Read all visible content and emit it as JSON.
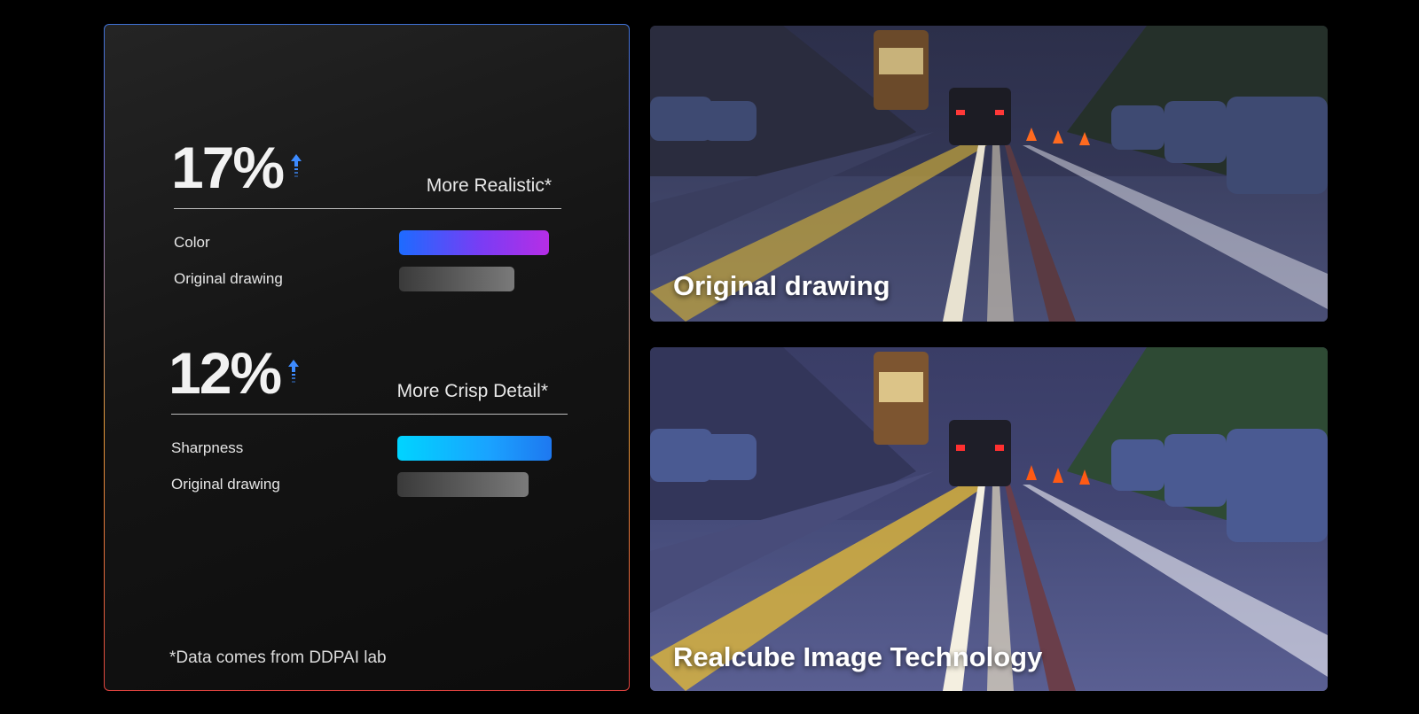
{
  "stats": [
    {
      "percent": "17%",
      "tagline": "More Realistic*",
      "row_a_label": "Color",
      "row_b_label": "Original drawing",
      "bar_a_color_start": "#1d6bff",
      "bar_a_color_end": "#b62ee6"
    },
    {
      "percent": "12%",
      "tagline": "More Crisp Detail*",
      "row_a_label": "Sharpness",
      "row_b_label": "Original drawing",
      "bar_a_color_start": "#00d4ff",
      "bar_a_color_end": "#1e78f0"
    }
  ],
  "footnote": "*Data comes from DDPAI lab",
  "photos": {
    "top_caption": "Original drawing",
    "bottom_caption": "Realcube Image Technology"
  },
  "colors": {
    "background": "#000000",
    "arrow": "#3d8bff",
    "card_border_top": "#3f72d6",
    "card_border_bottom": "#e0433f"
  },
  "icons": {
    "up_arrow": "arrow-up-icon"
  }
}
